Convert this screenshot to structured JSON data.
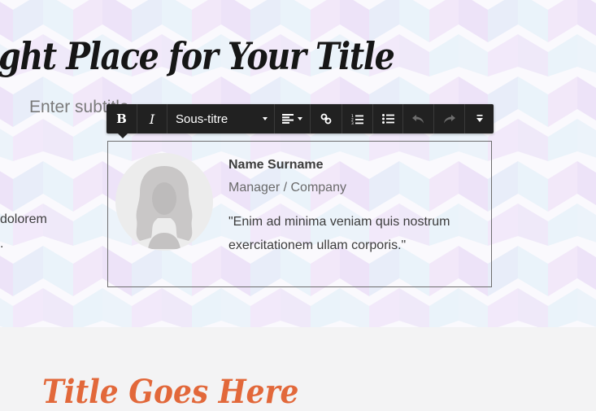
{
  "hero": {
    "title": "ght Place for Your Title",
    "subtitle_placeholder": "Enter subtitle",
    "left_text_line1": "dolorem",
    "left_text_line2": "."
  },
  "toolbar": {
    "bold": "B",
    "italic": "I",
    "style_select": "Sous-titre",
    "buttons": [
      "bold",
      "italic",
      "paragraph-style",
      "align",
      "link",
      "ordered-list",
      "unordered-list",
      "undo",
      "redo",
      "more"
    ],
    "disabled": [
      "undo",
      "redo"
    ]
  },
  "testimonial": {
    "name": "Name Surname",
    "role": "Manager / Company",
    "quote": "\"Enim ad minima veniam quis nostrum exercitationem ullam corporis.\""
  },
  "section2": {
    "title": "Title Goes Here"
  },
  "colors": {
    "toolbar_bg": "#212121",
    "accent_orange": "#e2683a",
    "card_border": "#6e6e6e"
  }
}
